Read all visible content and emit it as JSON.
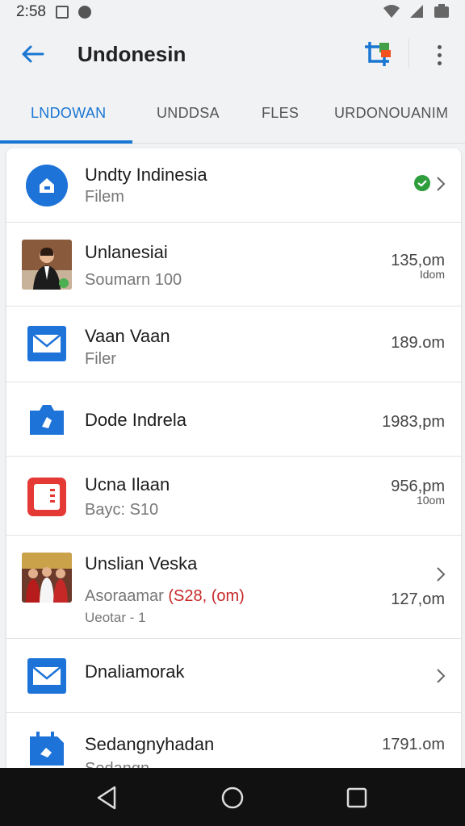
{
  "status_bar": {
    "time": "2:58"
  },
  "app_bar": {
    "title": "Undonesin"
  },
  "tabs": [
    {
      "label": "LNDOWAN",
      "active": true
    },
    {
      "label": "UNDDSA",
      "active": false
    },
    {
      "label": "FLES",
      "active": false
    },
    {
      "label": "URDONOUANIM",
      "active": false
    }
  ],
  "rows": [
    {
      "title": "Undty Indinesia",
      "sub": "Filem",
      "icon": "home-icon"
    },
    {
      "title": "Unlanesiai",
      "sub": "Soumarn 100",
      "time": "135,om",
      "time_small": "Idom",
      "icon": "profile-photo"
    },
    {
      "title": "Vaan Vaan",
      "sub": "Filer",
      "time": "189.om",
      "icon": "mail-icon"
    },
    {
      "title": "Dode Indrela",
      "time": "1983,pm",
      "icon": "camera-icon"
    },
    {
      "title": "Ucna Ilaan",
      "sub": "Bayc: S10",
      "time": "956,pm",
      "time_small": "10om",
      "icon": "document-icon"
    },
    {
      "title": "Unslian Veska",
      "sub_prefix": "Asoraamar",
      "sub_red": "(S28, (om)",
      "sub2": "Ueotar  -  1",
      "time": "127,om",
      "icon": "group-photo"
    },
    {
      "title": "Dnaliamorak",
      "icon": "mail-icon"
    },
    {
      "title": "Sedangnyhadan",
      "sub": "Sedangn",
      "time": "1791.om",
      "icon": "calendar-icon"
    }
  ],
  "colors": {
    "accent": "#1976d2",
    "icon_blue": "#1e73d8",
    "badge_green": "#2e9d3c",
    "doc_red": "#e53935"
  }
}
